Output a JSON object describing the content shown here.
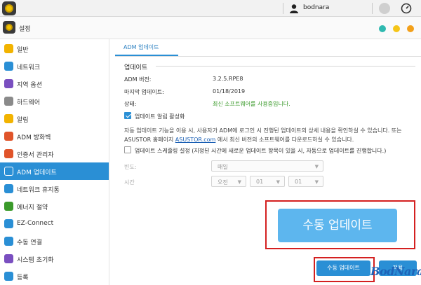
{
  "topbar": {
    "username": "bodnara"
  },
  "window": {
    "title": "설정"
  },
  "colors": {
    "accent": "#2a8fd5",
    "dot_teal": "#2fb9b0",
    "dot_yellow": "#f5c518",
    "dot_orange": "#f3a01a",
    "status_green": "#3a9a2a",
    "highlight_red": "#d42020"
  },
  "sidebar": {
    "items": [
      {
        "label": "일반",
        "icon": "gear-icon",
        "color": "#f2b300"
      },
      {
        "label": "네트워크",
        "icon": "globe-icon",
        "color": "#2a8fd5"
      },
      {
        "label": "지역 옵션",
        "icon": "region-icon",
        "color": "#7a4fc0"
      },
      {
        "label": "하드웨어",
        "icon": "hardware-icon",
        "color": "#8a8a8a"
      },
      {
        "label": "알림",
        "icon": "alert-icon",
        "color": "#f2b300"
      },
      {
        "label": "ADM 방화벽",
        "icon": "firewall-icon",
        "color": "#e0542a"
      },
      {
        "label": "인증서 관리자",
        "icon": "certificate-icon",
        "color": "#e0542a"
      },
      {
        "label": "ADM 업데이트",
        "icon": "update-icon",
        "color": "#ffffff"
      },
      {
        "label": "네트워크 휴지통",
        "icon": "recycle-icon",
        "color": "#2a8fd5"
      },
      {
        "label": "에너지 절약",
        "icon": "leaf-icon",
        "color": "#3a9a2a"
      },
      {
        "label": "EZ-Connect",
        "icon": "ezconnect-icon",
        "color": "#2a8fd5"
      },
      {
        "label": "수동 연결",
        "icon": "manual-connect-icon",
        "color": "#2a8fd5"
      },
      {
        "label": "시스템 초기화",
        "icon": "reset-icon",
        "color": "#7a4fc0"
      },
      {
        "label": "등록",
        "icon": "register-icon",
        "color": "#2a8fd5"
      }
    ],
    "active_index": 7
  },
  "main": {
    "tab": "ADM 업데이트",
    "section_title": "업데이트",
    "rows": [
      {
        "label": "ADM 버전:",
        "value": "3.2.5.RPE8"
      },
      {
        "label": "마지막 업데이트:",
        "value": "01/18/2019"
      },
      {
        "label": "상태:",
        "value": "최신 소프트웨어를 사용중입니다."
      }
    ],
    "notify_checkbox": {
      "label": "업데이트 알림 활성화",
      "checked": true
    },
    "description_1": "자동 업데이트 기능을 이용 시, 사용자가 ADM에 로그인 시 진행된 업데이트의 상세 내용을 확인하실 수 있습니다. 또는",
    "description_2a": "ASUSTOR 홈페이지 ",
    "description_link": "ASUSTOR.com",
    "description_2b": " 에서 최신 버전의 소프트웨어를 다운로드하실 수 있습니다.",
    "schedule_checkbox": {
      "label": "업데이트 스케줄링 설정 (지정된 시간에 새로운 업데이트 항목이 있을 시, 자동으로 업데이트를 진행합니다.)",
      "checked": false
    },
    "frequency": {
      "label": "빈도:",
      "value": "매일"
    },
    "time": {
      "label": "시간",
      "ampm": "오전",
      "hour": "01",
      "minute": "01"
    },
    "big_button": "수동 업데이트",
    "manual_update_button": "수동 업데이트",
    "apply_button": "적용"
  },
  "watermark": "BodNara"
}
